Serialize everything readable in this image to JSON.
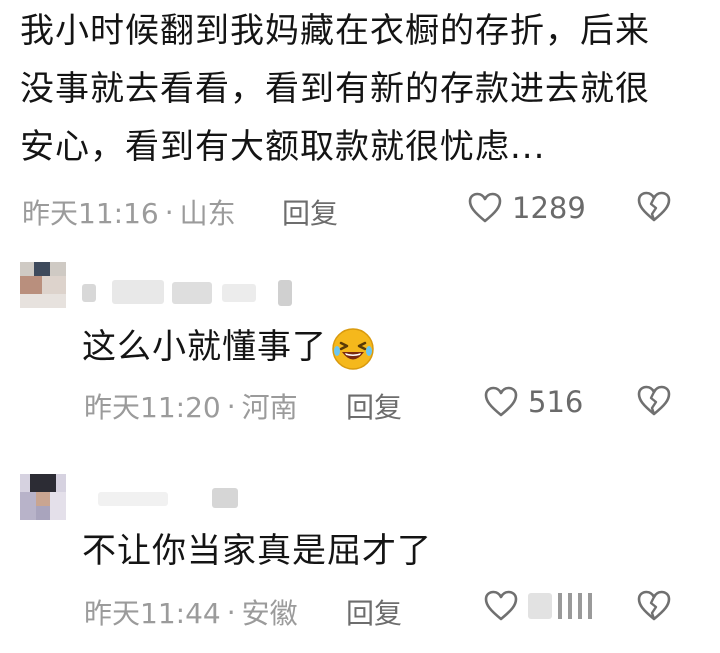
{
  "comments": [
    {
      "text_lines": [
        "我小时候翻到我妈藏在衣橱的存折，后来",
        "没事就去看看，看到有新的存款进去就很",
        "安心，看到有大额取款就很忧虑..."
      ],
      "time": "昨天11:16",
      "location": "山东",
      "reply_label": "回复",
      "likes": "1289"
    },
    {
      "text": "这么小就懂事了",
      "emoji": "laughing-tears-emoji",
      "time": "昨天11:20",
      "location": "河南",
      "reply_label": "回复",
      "likes": "516"
    },
    {
      "text": "不让你当家真是屈才了",
      "time": "昨天11:44",
      "location": "安徽",
      "reply_label": "回复"
    }
  ],
  "separator": "·",
  "icons": {
    "like": "heart-outline-icon",
    "dislike": "broken-heart-icon"
  },
  "colors": {
    "text": "#141414",
    "meta": "#9b9b9b",
    "emoji": "#f5b81c"
  }
}
